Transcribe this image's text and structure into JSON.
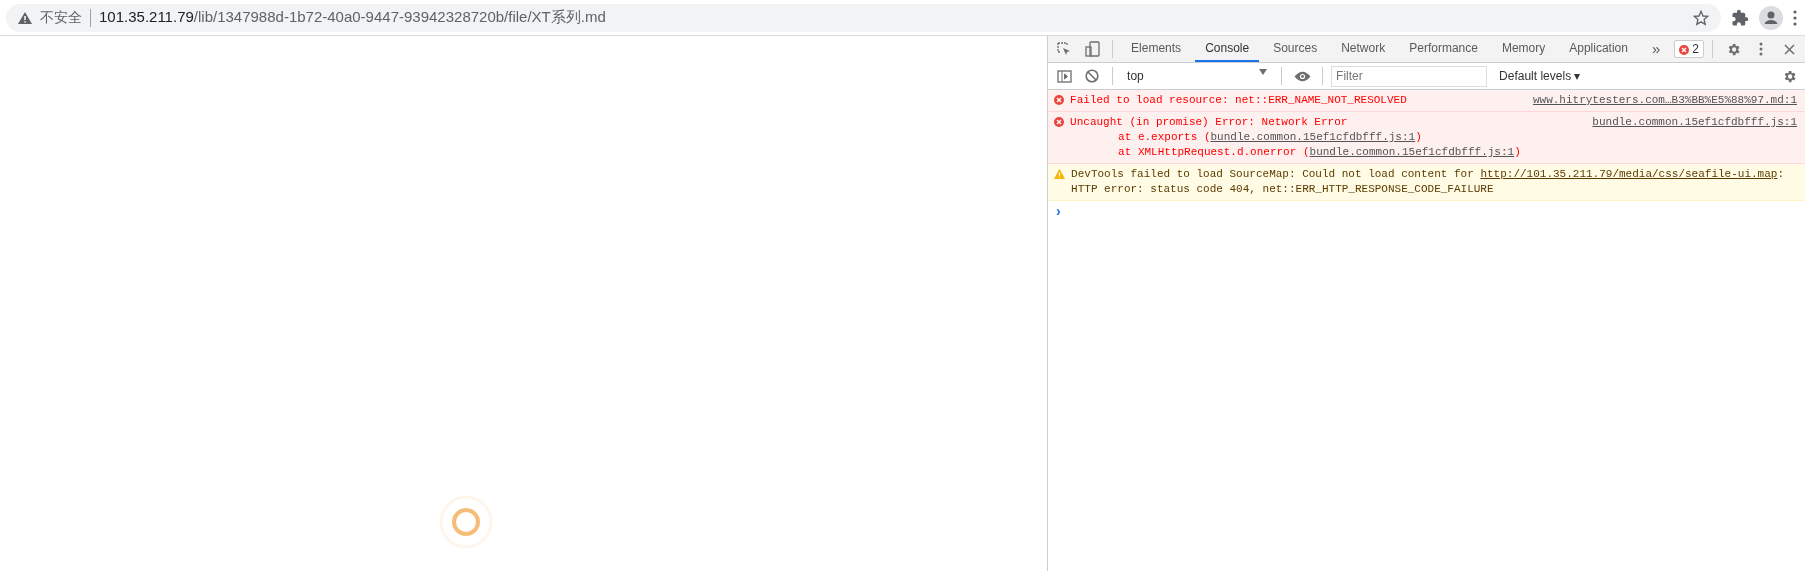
{
  "address_bar": {
    "security_label": "不安全",
    "url_host": "101.35.211.79",
    "url_path": "/lib/1347988d-1b72-40a0-9447-93942328720b/file/XT系列.md"
  },
  "devtools": {
    "tabs": [
      {
        "label": "Elements",
        "selected": false
      },
      {
        "label": "Console",
        "selected": true
      },
      {
        "label": "Sources",
        "selected": false
      },
      {
        "label": "Network",
        "selected": false
      },
      {
        "label": "Performance",
        "selected": false
      },
      {
        "label": "Memory",
        "selected": false
      },
      {
        "label": "Application",
        "selected": false
      }
    ],
    "more_tabs": "»",
    "error_count": "2",
    "console_toolbar": {
      "context": "top",
      "filter_placeholder": "Filter",
      "levels": "Default levels ▾"
    },
    "messages": [
      {
        "kind": "error",
        "text": "Failed to load resource: net::ERR_NAME_NOT_RESOLVED",
        "source": "www.hitrytesters.com…B3%BB%E5%88%97.md:1"
      },
      {
        "kind": "error",
        "text": "Uncaught (in promise) Error: Network Error",
        "source": "bundle.common.15ef1cfdbfff.js:1",
        "stack": [
          {
            "prefix": "at e.exports (",
            "link": "bundle.common.15ef1cfdbfff.js:1",
            "suffix": ")"
          },
          {
            "prefix": "at XMLHttpRequest.d.onerror (",
            "link": "bundle.common.15ef1cfdbfff.js:1",
            "suffix": ")"
          }
        ]
      },
      {
        "kind": "warning",
        "text": "DevTools failed to load SourceMap: Could not load content for ",
        "link": "http://101.35.211.79/media/css/seafile-ui.map",
        "text_after": ": HTTP error: status code 404, net::ERR_HTTP_RESPONSE_CODE_FAILURE"
      }
    ],
    "prompt": "›"
  }
}
